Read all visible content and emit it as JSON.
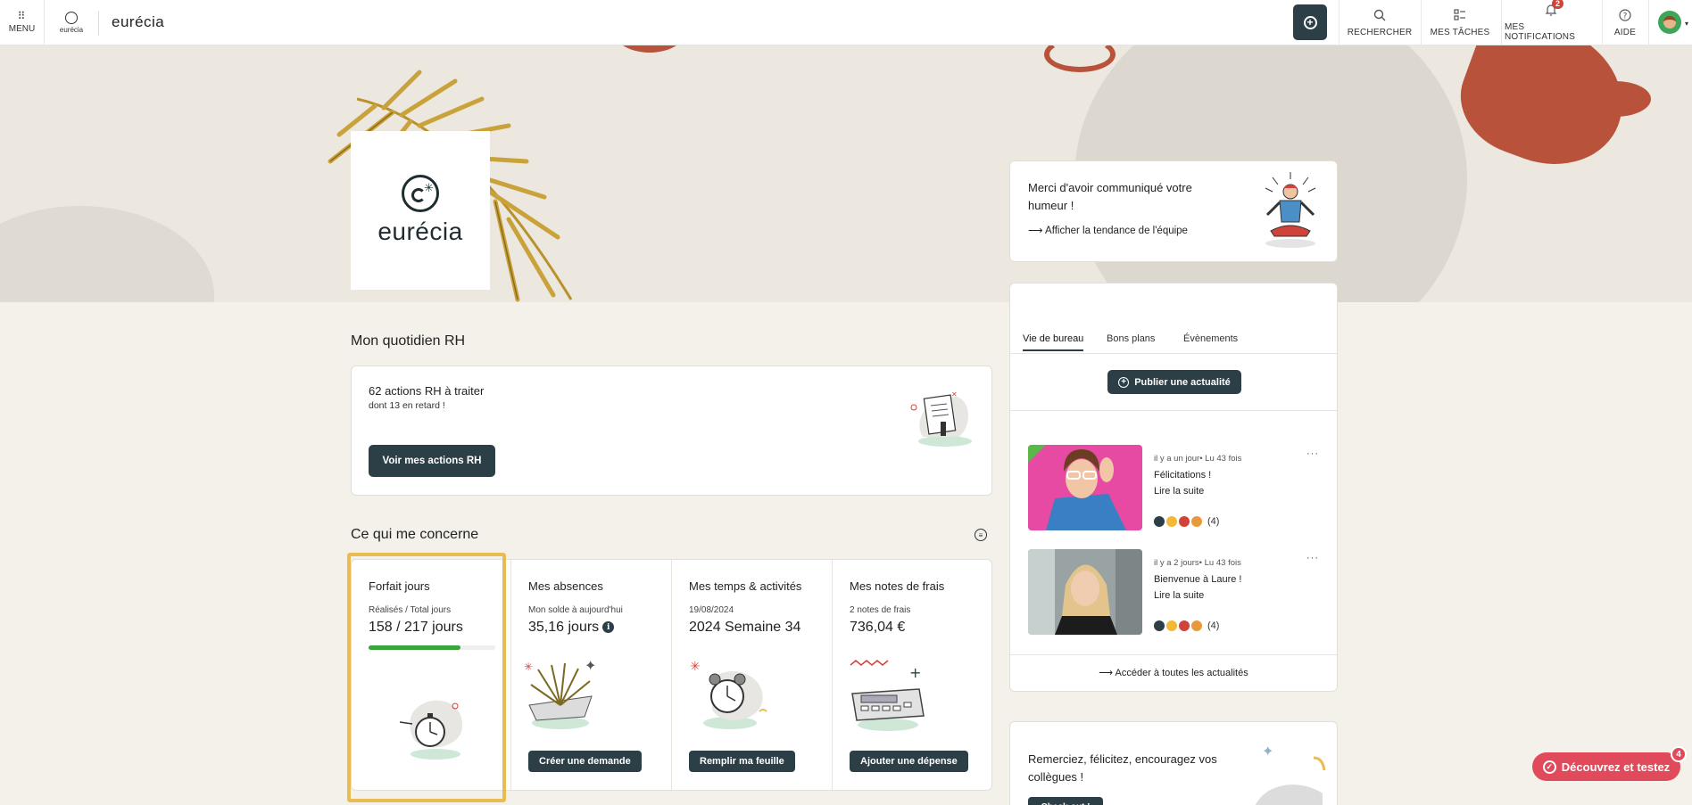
{
  "topbar": {
    "menu_label": "MENU",
    "small_logo_text": "eurécia",
    "brand": "eurécia",
    "search_label": "RECHERCHER",
    "tasks_label": "MES TÂCHES",
    "notifications_label": "MES NOTIFICATIONS",
    "notifications_count": "2",
    "help_label": "AIDE"
  },
  "hero": {
    "logo_word": "eurécia"
  },
  "rh": {
    "section_title": "Mon quotidien RH",
    "actions_count_text": "62 actions RH à traiter",
    "late_text": "dont 13 en retard !",
    "button_label": "Voir mes actions RH"
  },
  "concerne": {
    "section_title": "Ce qui me concerne",
    "tiles": [
      {
        "title": "Forfait jours",
        "sub": "Réalisés / Total jours",
        "value": "158 / 217 jours",
        "progress": 0.728
      },
      {
        "title": "Mes absences",
        "sub": "Mon solde à aujourd'hui",
        "value": "35,16 jours",
        "button": "Créer une demande"
      },
      {
        "title": "Mes temps & activités",
        "sub": "19/08/2024",
        "value": "2024 Semaine 34",
        "button": "Remplir ma feuille"
      },
      {
        "title": "Mes notes de frais",
        "sub": "2 notes de frais",
        "value": "736,04 €",
        "button": "Ajouter une dépense"
      }
    ]
  },
  "mood": {
    "text": "Merci d'avoir communiqué votre humeur !",
    "link": "Afficher la tendance de l'équipe"
  },
  "news": {
    "tabs": [
      "Vie de bureau",
      "Bons plans",
      "Évènements"
    ],
    "publish_label": "Publier une actualité",
    "posts": [
      {
        "meta": "il y a un jour• Lu 43 fois",
        "title": "Félicitations !",
        "more": "Lire la suite",
        "reactions_count": "(4)"
      },
      {
        "meta": "il y a 2 jours• Lu 43 fois",
        "title": "Bienvenue à Laure !",
        "more": "Lire la suite",
        "reactions_count": "(4)"
      }
    ],
    "all_link": "Accéder à toutes les actualités"
  },
  "thanks": {
    "text": "Remerciez, félicitez, encouragez vos collègues !",
    "button_label": "Check-out !"
  },
  "discover": {
    "label": "Découvrez et testez",
    "badge": "4"
  },
  "colors": {
    "primary_dark": "#2c3e46",
    "accent_terracotta": "#b9523b",
    "progress_green": "#3aa53a",
    "highlight_yellow": "#e8bc52",
    "discover_pink": "#e04a5a"
  }
}
